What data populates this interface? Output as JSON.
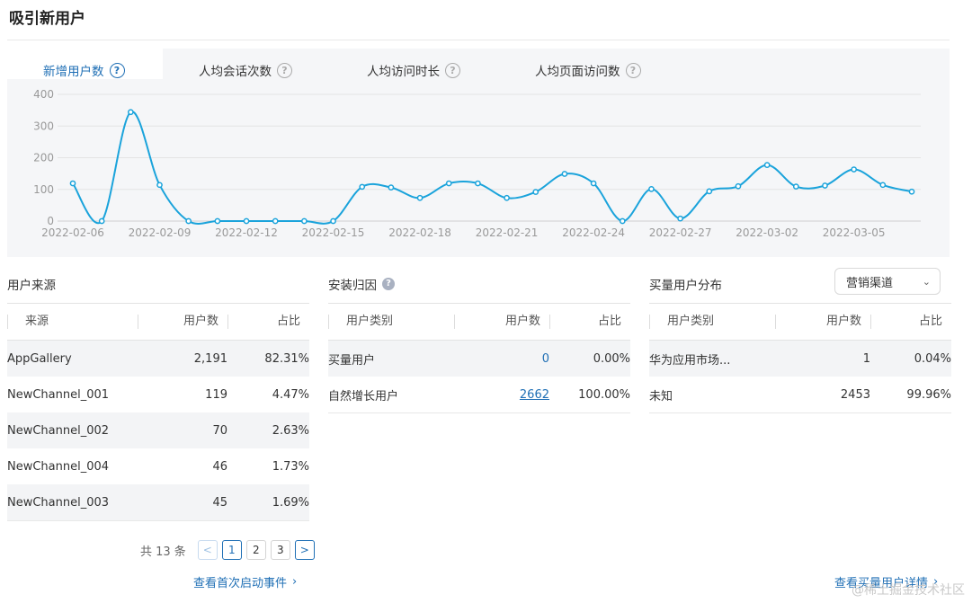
{
  "page_title": "吸引新用户",
  "tabs": [
    {
      "label": "新增用户数",
      "active": true
    },
    {
      "label": "人均会话次数",
      "active": false
    },
    {
      "label": "人均访问时长",
      "active": false
    },
    {
      "label": "人均页面访问数",
      "active": false
    }
  ],
  "help_icon": "?",
  "chart_data": {
    "type": "line",
    "x": [
      "2022-02-06",
      "2022-02-07",
      "2022-02-08",
      "2022-02-09",
      "2022-02-10",
      "2022-02-11",
      "2022-02-12",
      "2022-02-13",
      "2022-02-14",
      "2022-02-15",
      "2022-02-16",
      "2022-02-17",
      "2022-02-18",
      "2022-02-19",
      "2022-02-20",
      "2022-02-21",
      "2022-02-22",
      "2022-02-23",
      "2022-02-24",
      "2022-02-25",
      "2022-02-26",
      "2022-02-27",
      "2022-02-28",
      "2022-03-01",
      "2022-03-02",
      "2022-03-03",
      "2022-03-04",
      "2022-03-05",
      "2022-03-06",
      "2022-03-07"
    ],
    "series": [
      {
        "values": [
          119,
          0,
          344,
          114,
          0,
          0,
          0,
          0,
          0,
          0,
          108,
          106,
          73,
          119,
          119,
          73,
          92,
          149,
          119,
          0,
          101,
          8,
          94,
          110,
          177,
          109,
          112,
          163,
          114,
          93
        ]
      }
    ],
    "x_tick_labels": [
      "2022-02-06",
      "2022-02-09",
      "2022-02-12",
      "2022-02-15",
      "2022-02-18",
      "2022-02-21",
      "2022-02-24",
      "2022-02-27",
      "2022-03-02",
      "2022-03-05"
    ],
    "y_ticks": [
      0,
      100,
      200,
      300,
      400
    ],
    "ylim": [
      0,
      400
    ],
    "grid": true,
    "color": "#1aa3db"
  },
  "user_source": {
    "title": "用户来源",
    "headers": [
      "来源",
      "用户数",
      "占比"
    ],
    "rows": [
      [
        "AppGallery",
        "2,191",
        "82.31%"
      ],
      [
        "NewChannel_001",
        "119",
        "4.47%"
      ],
      [
        "NewChannel_002",
        "70",
        "2.63%"
      ],
      [
        "NewChannel_004",
        "46",
        "1.73%"
      ],
      [
        "NewChannel_003",
        "45",
        "1.69%"
      ]
    ],
    "pagination": {
      "total": "共 13 条",
      "prev": "<",
      "pages": [
        "1",
        "2",
        "3"
      ],
      "current": "1",
      "next": ">"
    },
    "link": "查看首次启动事件"
  },
  "install_attr": {
    "title": "安装归因",
    "info_icon": "?",
    "headers": [
      "用户类别",
      "用户数",
      "占比"
    ],
    "rows": [
      [
        "买量用户",
        "0",
        "0.00%"
      ],
      [
        "自然增长用户",
        "2662",
        "100.00%"
      ]
    ]
  },
  "paid_users": {
    "title": "买量用户分布",
    "select_value": "营销渠道",
    "headers": [
      "用户类别",
      "用户数",
      "占比"
    ],
    "rows": [
      [
        "华为应用市场...",
        "1",
        "0.04%"
      ],
      [
        "未知",
        "2453",
        "99.96%"
      ]
    ],
    "link": "查看买量用户详情"
  },
  "chevron": "›",
  "watermark": "@稀土掘金技术社区",
  "colors": {
    "accent": "#1f6fb5",
    "line": "#1aa3db",
    "panel": "#f5f6f8"
  }
}
